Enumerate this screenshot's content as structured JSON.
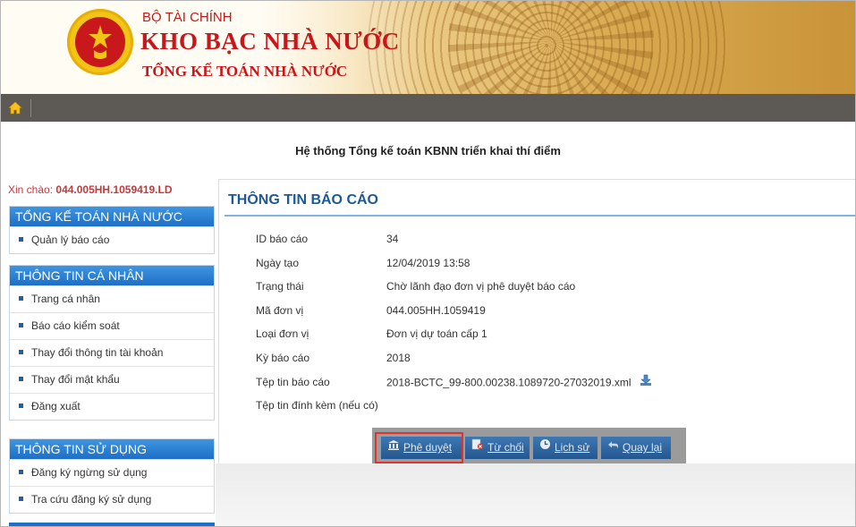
{
  "header": {
    "ministry": "BỘ TÀI CHÍNH",
    "org_name": "KHO BẠC NHÀ NƯỚC",
    "org_sub": "TỔNG KẾ TOÁN NHÀ NƯỚC"
  },
  "navbar": {
    "home_icon": "home-icon"
  },
  "system_title": "Hệ thống Tổng kế toán KBNN triển khai thí điểm",
  "sidebar": {
    "greeting_prefix": "Xin chào:",
    "username": "044.005HH.1059419.LD",
    "sections": [
      {
        "title": "TỔNG KẾ TOÁN NHÀ NƯỚC",
        "items": [
          "Quản lý báo cáo"
        ]
      },
      {
        "title": "THÔNG TIN CÁ NHÂN",
        "items": [
          "Trang cá nhân",
          "Báo cáo kiểm soát",
          "Thay đổi thông tin tài khoản",
          "Thay đổi mật khẩu",
          "Đăng xuất"
        ]
      },
      {
        "title": "THÔNG TIN SỬ DỤNG",
        "items": [
          "Đăng ký ngừng sử dụng",
          "Tra cứu đăng ký sử dụng"
        ]
      }
    ]
  },
  "report": {
    "title": "THÔNG TIN BÁO CÁO",
    "fields": [
      {
        "label": "ID báo cáo",
        "value": "34"
      },
      {
        "label": "Ngày tạo",
        "value": "12/04/2019 13:58"
      },
      {
        "label": "Trạng thái",
        "value": "Chờ lãnh đạo đơn vị phê duyệt báo cáo"
      },
      {
        "label": "Mã đơn vị",
        "value": "044.005HH.1059419"
      },
      {
        "label": "Loại đơn vị",
        "value": "Đơn vị dự toán cấp 1"
      },
      {
        "label": "Kỳ báo cáo",
        "value": "2018"
      },
      {
        "label": "Tệp tin báo cáo",
        "value": "2018-BCTC_99-800.00238.1089720-27032019.xml"
      },
      {
        "label": "Tệp tin đính kèm (nếu có)",
        "value": ""
      }
    ],
    "download_icon": "download-icon"
  },
  "actions": {
    "approve": "Phê duyệt",
    "reject": "Từ chối",
    "history": "Lịch sử",
    "back": "Quay lại"
  },
  "colors": {
    "brand_red": "#c8161b",
    "nav_bar": "#5d5a55",
    "panel_header_blue": "#1d6fc6",
    "title_blue": "#1c5a96",
    "button_blue": "#25578f",
    "highlight": "#e0322e"
  }
}
